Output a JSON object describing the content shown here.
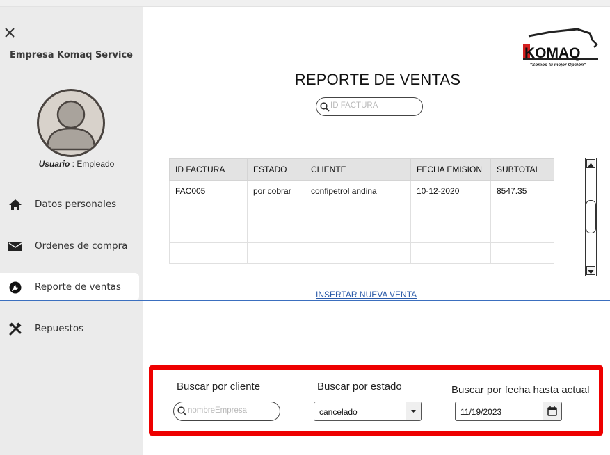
{
  "sidebar": {
    "company_name": "Empresa Komaq Service",
    "user_role_label": "Usuario",
    "user_role_value": " : Empleado",
    "items": [
      {
        "label": "Datos personales",
        "icon": "home-icon"
      },
      {
        "label": "Ordenes de compra",
        "icon": "mail-icon"
      },
      {
        "label": "Reporte de ventas",
        "icon": "wrench-icon",
        "active": true
      },
      {
        "label": "Repuestos",
        "icon": "tools-icon"
      }
    ]
  },
  "logo": {
    "brand": "KOMAQ",
    "slogan": "\"Somos tu mejor Opción\""
  },
  "main": {
    "title": "REPORTE DE VENTAS",
    "search_placeholder": "ID FACTURA",
    "table": {
      "columns": [
        "ID FACTURA",
        "ESTADO",
        "CLIENTE",
        "FECHA EMISION",
        "SUBTOTAL"
      ],
      "rows": [
        [
          "FAC005",
          "por cobrar",
          "confipetrol andina",
          "10-12-2020",
          "8547.35"
        ],
        [
          "",
          "",
          "",
          "",
          ""
        ],
        [
          "",
          "",
          "",
          "",
          ""
        ],
        [
          "",
          "",
          "",
          "",
          ""
        ]
      ]
    },
    "insert_link": "INSERTAR NUEVA VENTA"
  },
  "filters": {
    "client_label": "Buscar por cliente",
    "client_placeholder": "nombreEmpresa",
    "status_label": "Buscar por estado",
    "status_value": "cancelado",
    "date_label": "Buscar por fecha hasta actual",
    "date_value": "11/19/2023"
  },
  "colors": {
    "highlight_border": "#ee0000",
    "link": "#2a5aa8",
    "sidebar_bg": "#ebebeb",
    "brand_red": "#d42020"
  }
}
